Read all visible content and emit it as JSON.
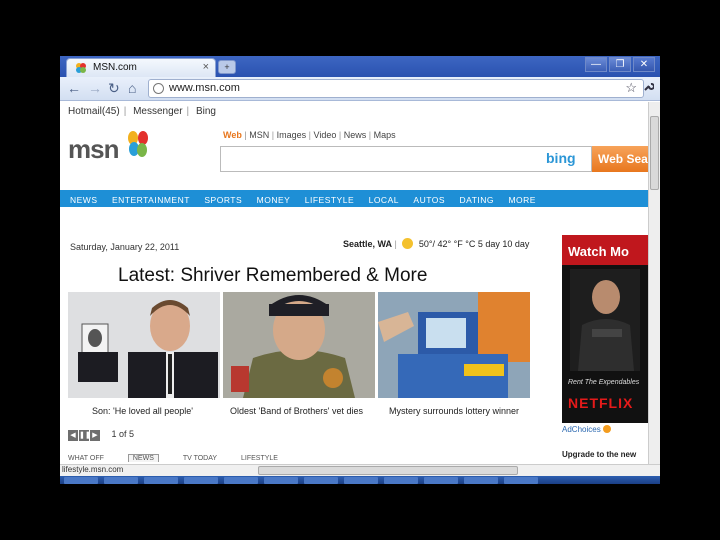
{
  "browser": {
    "tab_title": "MSN.com",
    "tab_close": "×",
    "new_tab": "+",
    "address": "www.msn.com",
    "window_buttons": {
      "minimize": "—",
      "maximize": "❐",
      "close": "✕"
    },
    "nav_icons": {
      "back": "←",
      "forward": "→",
      "reload": "↻",
      "home": "⌂",
      "star": "☆",
      "wrench": "🔧"
    }
  },
  "page": {
    "topnav": [
      "Hotmail(45)",
      "Messenger",
      "Bing"
    ],
    "logo_text": "msn",
    "search_tabs": [
      "Web",
      "MSN",
      "Images",
      "Video",
      "News",
      "Maps"
    ],
    "bing_logo": "bing",
    "search_button": "Web Sea",
    "main_nav": [
      "NEWS",
      "ENTERTAINMENT",
      "SPORTS",
      "MONEY",
      "LIFESTYLE",
      "LOCAL",
      "AUTOS",
      "DATING",
      "MORE"
    ],
    "date": "Saturday, January 22, 2011",
    "weather": {
      "city": "Seattle, WA",
      "temp": "50°/ 42° °F °C",
      "forecast": "5 day 10 day"
    },
    "headline": "Latest: Shriver Remembered & More",
    "captions": [
      "Son: 'He loved all people'",
      "Oldest 'Band of Brothers' vet dies",
      "Mystery surrounds lottery winner"
    ],
    "pager": {
      "prev": "◀",
      "pause": "❚❚",
      "next": "▶",
      "count": "1 of 5"
    },
    "bottom_tabs": [
      "WHAT OFF",
      "NEWS",
      "TV TODAY",
      "LIFESTYLE"
    ],
    "ad": {
      "headline": "Watch Mo",
      "rent_text": "Rent The Expendables",
      "brand": "NETFLIX"
    },
    "adchoices": "AdChoices",
    "upgrade": "Upgrade to the new"
  },
  "status": {
    "url": "lifestyle.msn.com"
  },
  "colors": {
    "msn_blue": "#1e8fd6",
    "bing_orange": "#e8771e",
    "ad_red": "#c0171d"
  }
}
